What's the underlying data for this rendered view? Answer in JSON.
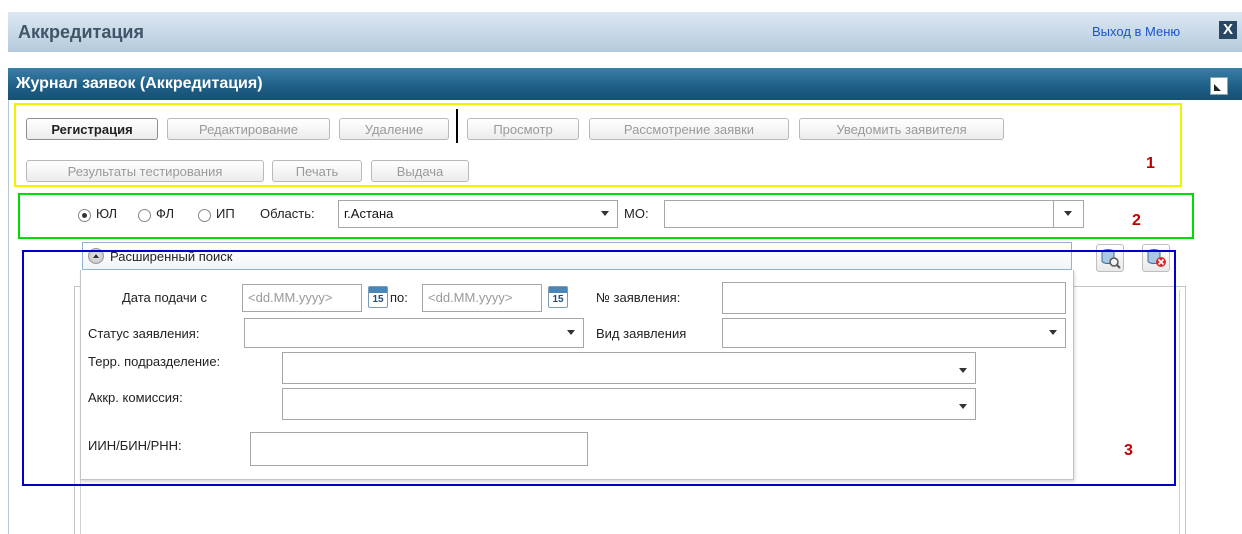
{
  "header": {
    "title": "Аккредитация",
    "exit_label": "Выход в Меню",
    "close_glyph": "X"
  },
  "panel": {
    "title": "Журнал заявок (Аккредитация)"
  },
  "toolbar": {
    "buttons": [
      {
        "label": "Регистрация",
        "enabled": true
      },
      {
        "label": "Редактирование",
        "enabled": false
      },
      {
        "label": "Удаление",
        "enabled": false
      },
      {
        "label": "Просмотр",
        "enabled": false
      },
      {
        "label": "Рассмотрение заявки",
        "enabled": false
      },
      {
        "label": "Уведомить заявителя",
        "enabled": false
      },
      {
        "label": "Результаты тестирования",
        "enabled": false
      },
      {
        "label": "Печать",
        "enabled": false
      },
      {
        "label": "Выдача",
        "enabled": false
      }
    ]
  },
  "filter": {
    "radios": [
      {
        "label": "ЮЛ",
        "checked": true
      },
      {
        "label": "ФЛ",
        "checked": false
      },
      {
        "label": "ИП",
        "checked": false
      }
    ],
    "region_label": "Область:",
    "region_value": "г.Астана",
    "mo_label": "МО:",
    "mo_value": ""
  },
  "advanced": {
    "title": "Расширенный поиск",
    "date_from_label": "Дата подачи с",
    "date_placeholder": "<dd.MM.yyyy>",
    "date_to_label": "по:",
    "calendar_day": "15",
    "app_number_label": "№ заявления:",
    "status_label": "Статус заявления:",
    "type_label": "Вид заявления",
    "terr_label": "Терр. подразделение:",
    "commission_label": "Аккр. комиссия:",
    "iin_label": "ИИН/БИН/РНН:"
  },
  "annotations": {
    "box1": "1",
    "box2": "2",
    "box3": "3",
    "colors": {
      "box1": "#f2f200",
      "box2": "#00dd00",
      "box3": "#0000cc",
      "labels": "#c00000"
    }
  },
  "icons": {
    "search": "database-search-icon",
    "clear": "database-clear-icon",
    "calendar": "calendar-icon",
    "maximize": "maximize-icon"
  }
}
